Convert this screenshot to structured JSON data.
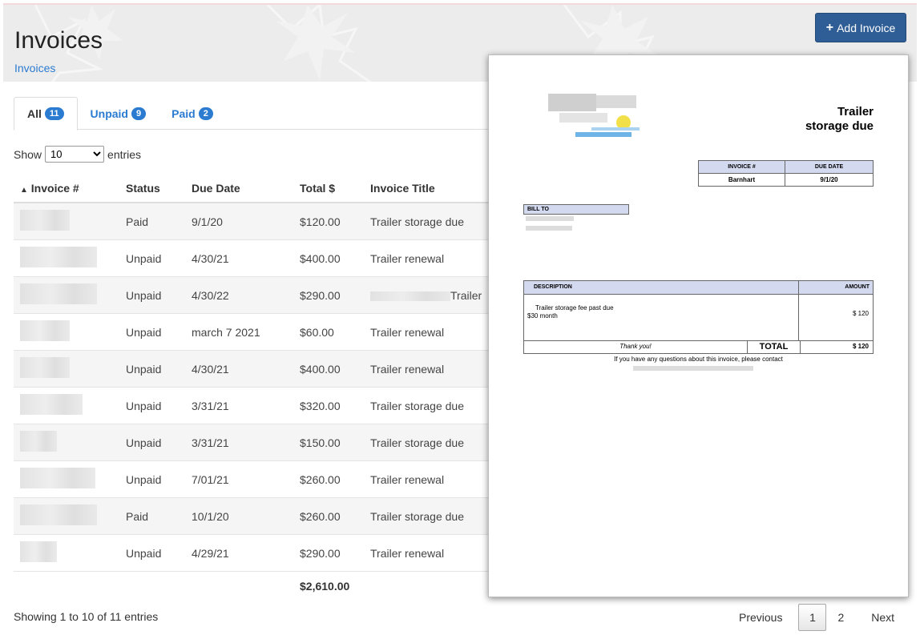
{
  "header": {
    "title": "Invoices",
    "breadcrumb": "Invoices",
    "add_button": "Add Invoice",
    "add_icon": "+"
  },
  "tabs": [
    {
      "label": "All",
      "count": "11"
    },
    {
      "label": "Unpaid",
      "count": "9"
    },
    {
      "label": "Paid",
      "count": "2"
    }
  ],
  "length": {
    "prefix": "Show",
    "value": "10",
    "suffix": "entries"
  },
  "table": {
    "sort_indicator": "▲",
    "columns": [
      "Invoice #",
      "Status",
      "Due Date",
      "Total $",
      "Invoice Title"
    ],
    "rows": [
      {
        "status": "Paid",
        "due": "9/1/20",
        "total": "$120.00",
        "title": "Trailer storage due"
      },
      {
        "status": "Unpaid",
        "due": "4/30/21",
        "total": "$400.00",
        "title": "Trailer renewal"
      },
      {
        "status": "Unpaid",
        "due": "4/30/22",
        "total": "$290.00",
        "title": "Trailer"
      },
      {
        "status": "Unpaid",
        "due": "march 7 2021",
        "total": "$60.00",
        "title": "Trailer renewal"
      },
      {
        "status": "Unpaid",
        "due": "4/30/21",
        "total": "$400.00",
        "title": "Trailer renewal"
      },
      {
        "status": "Unpaid",
        "due": "3/31/21",
        "total": "$320.00",
        "title": "Trailer storage due"
      },
      {
        "status": "Unpaid",
        "due": "3/31/21",
        "total": "$150.00",
        "title": "Trailer storage due"
      },
      {
        "status": "Unpaid",
        "due": "7/01/21",
        "total": "$260.00",
        "title": "Trailer renewal"
      },
      {
        "status": "Paid",
        "due": "10/1/20",
        "total": "$260.00",
        "title": "Trailer storage due"
      },
      {
        "status": "Unpaid",
        "due": "4/29/21",
        "total": "$290.00",
        "title": "Trailer renewal"
      }
    ],
    "total": "$2,610.00"
  },
  "info": "Showing 1 to 10 of 11 entries",
  "pagination": {
    "previous": "Previous",
    "pages": [
      "1",
      "2"
    ],
    "next": "Next"
  },
  "preview": {
    "title_line1": "Trailer",
    "title_line2": "storage due",
    "invoice_label": "INVOICE #",
    "due_label": "DUE DATE",
    "invoice_value": "Barnhart",
    "due_value": "9/1/20",
    "bill_to": "BILL TO",
    "description_label": "DESCRIPTION",
    "amount_label": "AMOUNT",
    "item_line1": "Trailer storage fee past due",
    "item_line2": "$30 month",
    "item_amount": "$ 120",
    "thank_you": "Thank you!",
    "total_label": "TOTAL",
    "total_value": "$ 120",
    "contact": "If you have any questions about this invoice, please contact"
  },
  "colors": {
    "accent": "#2b7bd1",
    "button": "#2f5e96",
    "table_header_fill": "#d3d9ef"
  }
}
